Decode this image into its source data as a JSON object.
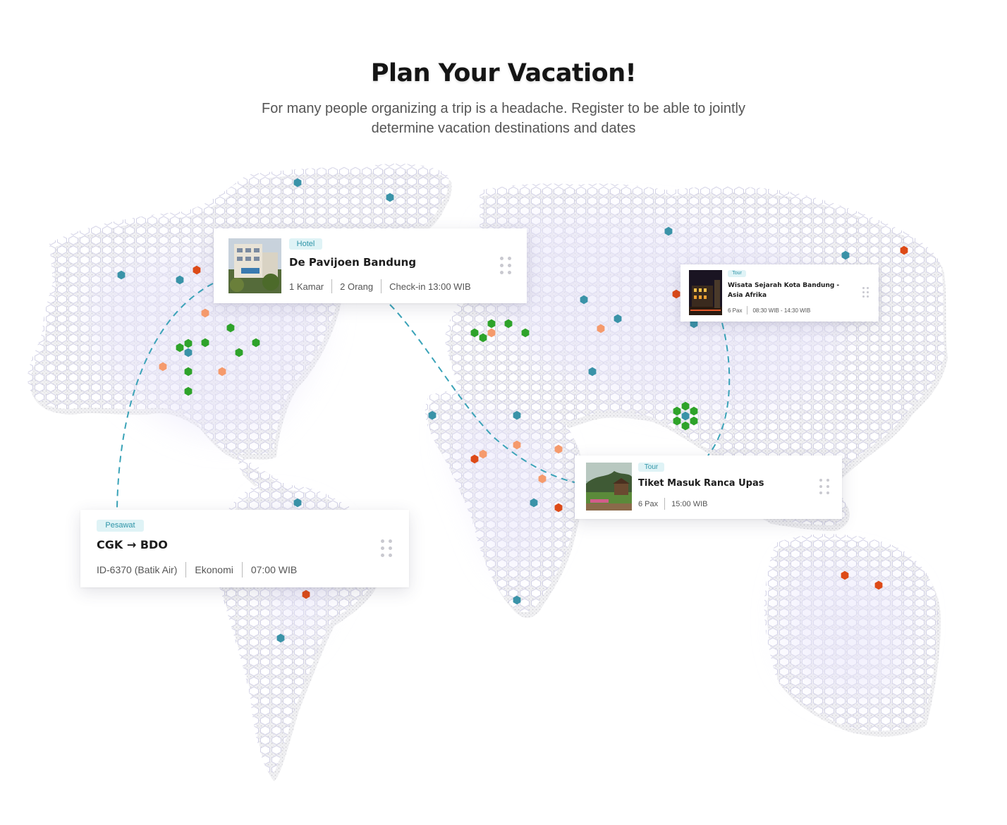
{
  "section": {
    "title": "Plan Your Vacation!",
    "subtitle": "For many people organizing a trip is a headache. Register to be able to jointly determine vacation destinations and dates"
  },
  "colors": {
    "accent_teal": "#3a93a8",
    "marker_green": "#2ea32a",
    "marker_orange": "#f59a6c",
    "marker_red": "#dd4a17",
    "tag_bg": "#dff3f6",
    "route_line": "#3aa3b8"
  },
  "cards": {
    "hotel": {
      "tag": "Hotel",
      "title": "De Pavijoen Bandung",
      "meta": [
        "1 Kamar",
        "2 Orang",
        "Check-in 13:00 WIB"
      ],
      "thumb_icon": "hotel-photo",
      "handle_icon": "drag-handle-icon"
    },
    "tour_asia": {
      "tag": "Tour",
      "title": "Wisata Sejarah Kota Bandung - Asia Afrika",
      "meta": [
        "6 Pax",
        "08:30 WIB - 14:30 WIB"
      ],
      "thumb_icon": "city-night-photo",
      "handle_icon": "drag-handle-icon"
    },
    "tour_ranca": {
      "tag": "Tour",
      "title": "Tiket Masuk Ranca Upas",
      "meta": [
        "6 Pax",
        "15:00 WIB"
      ],
      "thumb_icon": "park-photo",
      "handle_icon": "drag-handle-icon"
    },
    "flight": {
      "tag": "Pesawat",
      "title": "CGK → BDO",
      "meta": [
        "ID-6370 (Batik Air)",
        "Ekonomi",
        "07:00 WIB"
      ],
      "handle_icon": "drag-handle-icon"
    }
  }
}
